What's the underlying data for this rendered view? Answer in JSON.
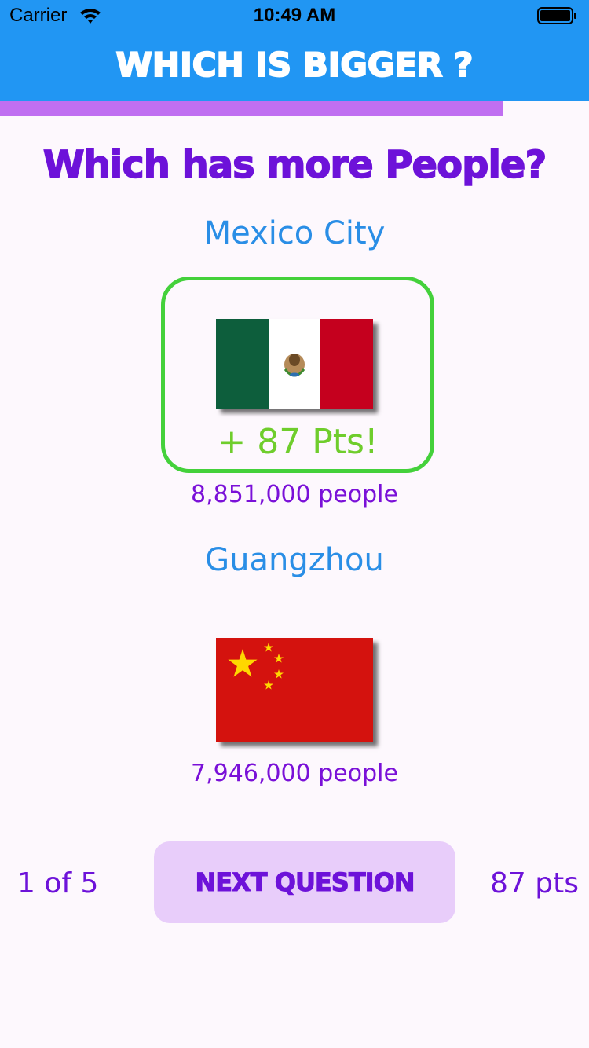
{
  "status_bar": {
    "carrier": "Carrier",
    "time": "10:49 AM"
  },
  "header": {
    "title": "WHICH IS BIGGER ?"
  },
  "progress": {
    "fraction": 0.853,
    "color": "#c06ff1"
  },
  "question": {
    "title": "Which has more People?"
  },
  "options": [
    {
      "name": "Mexico City",
      "flag_icon": "mexico-flag-icon",
      "points": "+ 87 Pts!",
      "population": "8,851,000 people",
      "selected": true
    },
    {
      "name": "Guangzhou",
      "flag_icon": "china-flag-icon",
      "population": "7,946,000 people",
      "selected": false
    }
  ],
  "footer": {
    "progress_text": "1 of 5",
    "next_label": "NEXT QUESTION",
    "score": "87 pts"
  },
  "colors": {
    "header_blue": "#2196f3",
    "accent_purple": "#6d12d9",
    "city_blue": "#2a8ee6",
    "correct_green": "#44d13b",
    "points_green": "#6fcd2c",
    "button_bg": "#e8cdfa"
  }
}
